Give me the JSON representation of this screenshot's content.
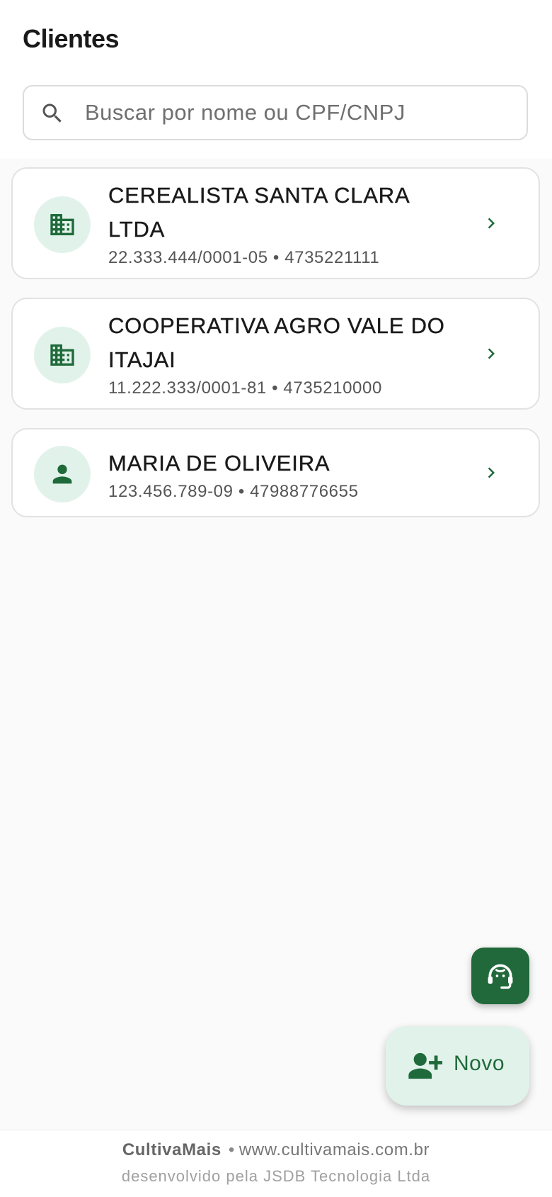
{
  "header": {
    "title": "Clientes"
  },
  "search": {
    "placeholder": "Buscar por nome ou CPF/CNPJ",
    "value": ""
  },
  "clients": [
    {
      "name": "CEREALISTA SANTA CLARA LTDA",
      "document": "22.333.444/0001-05",
      "phone": "4735221111",
      "subtitle": "22.333.444/0001-05 • 4735221111",
      "icon": "building-icon"
    },
    {
      "name": "COOPERATIVA AGRO VALE DO ITAJAI",
      "document": "11.222.333/0001-81",
      "phone": "4735210000",
      "subtitle": "11.222.333/0001-81 • 4735210000",
      "icon": "building-icon"
    },
    {
      "name": "MARIA DE OLIVEIRA",
      "document": "123.456.789-09",
      "phone": "47988776655",
      "subtitle": "123.456.789-09 • 47988776655",
      "icon": "person-icon"
    }
  ],
  "fab": {
    "new_label": "Novo",
    "support_icon": "support-agent-icon",
    "new_icon": "person-add-icon"
  },
  "footer": {
    "brand": "CultivaMais",
    "separator": "•",
    "website": "www.cultivamais.com.br",
    "credit": "desenvolvido pela JSDB Tecnologia Ltda"
  },
  "colors": {
    "primary": "#21693a",
    "icon_bg": "#e1f2ea",
    "background": "#fafafa"
  }
}
